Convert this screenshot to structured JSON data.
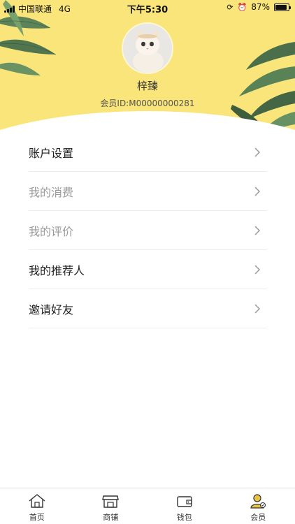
{
  "status_bar": {
    "carrier": "中国联通",
    "network": "4G",
    "time": "下午5:30",
    "battery": "87%",
    "battery_level": 0.87
  },
  "profile": {
    "name": "梓臻",
    "member_id": "会员ID:M00000000281"
  },
  "menu": {
    "items": [
      {
        "label": "账户设置"
      },
      {
        "label": "我的消费"
      },
      {
        "label": "我的评价"
      },
      {
        "label": "我的推荐人"
      },
      {
        "label": "邀请好友"
      }
    ]
  },
  "tabbar": {
    "items": [
      {
        "label": "首页",
        "icon": "home-icon"
      },
      {
        "label": "商铺",
        "icon": "shop-icon"
      },
      {
        "label": "钱包",
        "icon": "wallet-icon"
      },
      {
        "label": "会员",
        "icon": "member-icon"
      }
    ]
  },
  "colors": {
    "header_bg": "#f9e57a",
    "leaf_green": "#3f6b4b",
    "member_tab_accent": "#e7c53f"
  }
}
